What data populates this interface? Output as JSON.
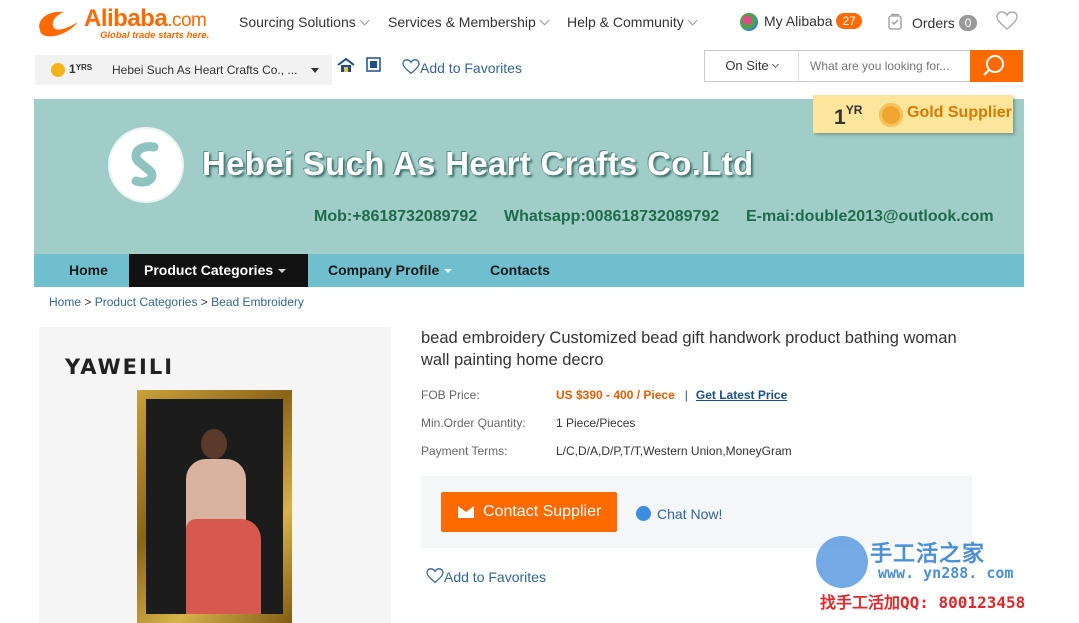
{
  "header": {
    "logo_text": "Alibaba",
    "logo_domain": ".com",
    "logo_tagline": "Global trade starts here.",
    "nav": [
      {
        "label": "Sourcing Solutions"
      },
      {
        "label": "Services & Membership"
      },
      {
        "label": "Help & Community"
      }
    ],
    "my_alibaba": {
      "label": "My Alibaba",
      "count": "27"
    },
    "orders": {
      "label": "Orders",
      "count": "0"
    },
    "brand_color": "#ff6a00"
  },
  "toolbar": {
    "supplier_years": "1",
    "supplier_years_unit": "YRS",
    "supplier_name": "Hebei Such As Heart Crafts Co., ...",
    "add_favorites": "Add to Favorites",
    "search_scope": "On Site",
    "search_placeholder": "What are you looking for..."
  },
  "banner": {
    "company_name": "Hebei Such As Heart Crafts Co.Ltd",
    "mobile": "Mob:+8618732089792",
    "whatsapp": "Whatsapp:008618732089792",
    "email": "E-mai:double2013@outlook.com",
    "gold_years": "1",
    "gold_years_unit": "YR",
    "gold_label": "Gold Supplier",
    "background": "#a1cdc9"
  },
  "company_nav": {
    "items": [
      {
        "label": "Home"
      },
      {
        "label": "Product Categories"
      },
      {
        "label": "Company Profile"
      },
      {
        "label": "Contacts"
      }
    ]
  },
  "breadcrumb": {
    "items": [
      "Home",
      "Product Categories",
      "Bead Embroidery"
    ],
    "separator": ">"
  },
  "product": {
    "image_brand": "YAWEILI",
    "title": "bead embroidery Customized bead gift handwork product bathing woman wall painting home decro",
    "fob_label": "FOB Price:",
    "fob_value": "US $390 - 400 / Piece",
    "get_price": "Get Latest Price",
    "moq_label": "Min.Order Quantity:",
    "moq_value": "1 Piece/Pieces",
    "payment_label": "Payment Terms:",
    "payment_value": "L/C,D/A,D/P,T/T,Western Union,MoneyGram",
    "contact_button": "Contact Supplier",
    "chat_now": "Chat Now!",
    "add_favorites": "Add to Favorites"
  },
  "watermark": {
    "title": "手工活之家",
    "url": "www. yn288. com",
    "qq": "找手工活加QQ: 800123458"
  }
}
